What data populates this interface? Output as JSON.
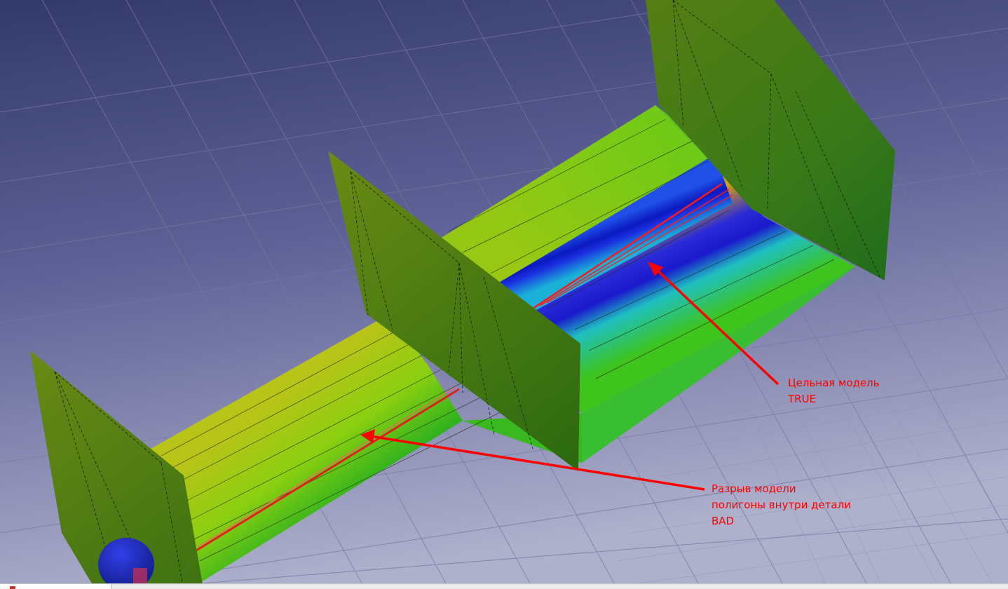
{
  "viewport": {
    "name": "3D viewport",
    "background_top": "#343a6c",
    "background_bottom": "#a7a9c7",
    "grid_color": "#6c6f98",
    "model_color": "#4f8f12"
  },
  "annotations": {
    "color": "#ff0000",
    "true_label": {
      "lines": [
        "Цельная модель",
        "TRUE"
      ]
    },
    "bad_label": {
      "lines": [
        "Разрыв модели",
        "полигоны внутри детали",
        "BAD"
      ]
    }
  },
  "statusbar": {
    "background": "#ececec"
  }
}
